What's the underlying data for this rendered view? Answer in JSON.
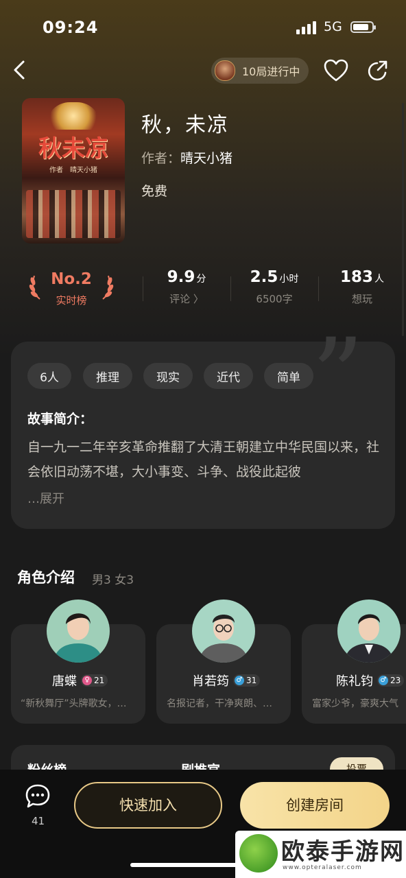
{
  "status_bar": {
    "time": "09:24",
    "network": "5G"
  },
  "nav": {
    "progress_text": "10局进行中"
  },
  "book": {
    "title": "秋，未凉",
    "author_label": "作者：",
    "author": "晴天小猪",
    "price": "免费",
    "cover_title": "秋未凉",
    "cover_author": "作者　晴天小猪"
  },
  "stats": {
    "rank": {
      "value": "No.2",
      "label": "实时榜"
    },
    "score": {
      "value": "9.9",
      "unit": "分",
      "label": "评论 〉"
    },
    "duration": {
      "value": "2.5",
      "unit": "小时",
      "label": "6500字"
    },
    "players": {
      "value": "183",
      "unit": "人",
      "label": "想玩"
    }
  },
  "tags": [
    {
      "label": "6人"
    },
    {
      "label": "推理"
    },
    {
      "label": "现实"
    },
    {
      "label": "近代"
    },
    {
      "label": "简单"
    }
  ],
  "story": {
    "heading": "故事简介：",
    "body": "自一九一二年辛亥革命推翻了大清王朝建立中华民国以来，社会依旧动荡不堪，大小事变、斗争、战役此起彼",
    "expand": "…展开"
  },
  "roles": {
    "heading": "角色介绍",
    "counts": "男3 女3",
    "items": [
      {
        "name": "唐蝶",
        "gender": "female",
        "age": "21",
        "desc": "“新秋舞厅”头牌歌女，…"
      },
      {
        "name": "肖若筠",
        "gender": "male",
        "age": "31",
        "desc": "名报记者，干净爽朗、…"
      },
      {
        "name": "陈礼钧",
        "gender": "male",
        "age": "23",
        "desc": "富家少爷，豪爽大气"
      }
    ]
  },
  "fans": {
    "title": "粉丝榜",
    "rec_title": "剧推官",
    "vote": "投票"
  },
  "bottom": {
    "chat_count": "41",
    "quick_join": "快速加入",
    "create_room": "创建房间"
  },
  "watermark": {
    "text": "欧泰手游网",
    "url": "www.opteralaser.com"
  },
  "colors": {
    "accent_gold": "#f3d489",
    "rank_red": "#f07b62",
    "female": "#e0588a",
    "male": "#3a9fd8"
  }
}
